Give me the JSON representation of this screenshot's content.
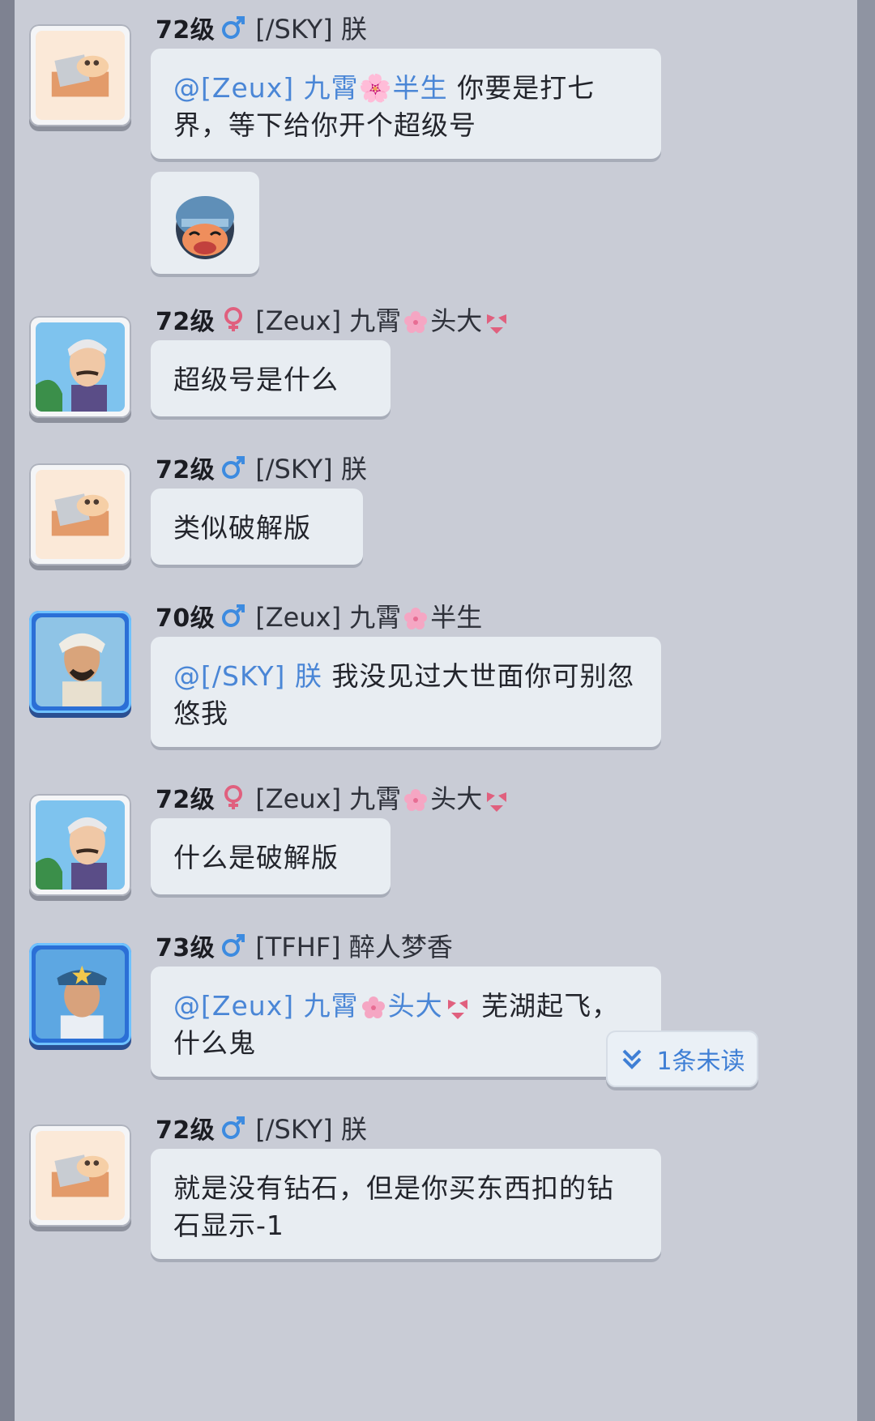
{
  "messages": [
    {
      "level": "72级",
      "gender": "male",
      "sender": "[/SKY] 朕",
      "mention": "@[Zeux] 九霄🌸半生",
      "text": "你要是打七界，等下给你开个超级号"
    },
    {
      "sticker": "soldier-helmet-laughing"
    },
    {
      "level": "72级",
      "gender": "female",
      "sender_a": "[Zeux] 九霄",
      "sender_b": "头大",
      "text": "超级号是什么"
    },
    {
      "level": "72级",
      "gender": "male",
      "sender": "[/SKY] 朕",
      "text": "类似破解版"
    },
    {
      "level": "70级",
      "gender": "male",
      "sender_a": "[Zeux] 九霄",
      "sender_b": "半生",
      "mention": "@[/SKY] 朕",
      "text": "我没见过大世面你可别忽悠我"
    },
    {
      "level": "72级",
      "gender": "female",
      "sender_a": "[Zeux] 九霄",
      "sender_b": "头大",
      "text": "什么是破解版"
    },
    {
      "level": "73级",
      "gender": "male",
      "sender": "[TFHF] 醉人梦香",
      "mention_a": "@[Zeux] 九霄",
      "mention_b": "头大",
      "text": "芜湖起飞，什么鬼"
    },
    {
      "level": "72级",
      "gender": "male",
      "sender": "[/SKY] 朕",
      "text": "就是没有钻石，但是你买东西扣的钻石显示-1"
    }
  ],
  "unread": {
    "label": "1条未读"
  },
  "colors": {
    "panel": "#c9ccd6",
    "bubble": "#e8edf2",
    "mention": "#4a86d6",
    "male_icon": "#3d8be0",
    "female_icon": "#e0607e"
  },
  "icons": {
    "male": "male-symbol-icon",
    "female": "female-symbol-icon",
    "flower": "cherry-blossom-icon",
    "bikini": "bikini-icon",
    "chevron": "double-chevron-down-icon"
  }
}
